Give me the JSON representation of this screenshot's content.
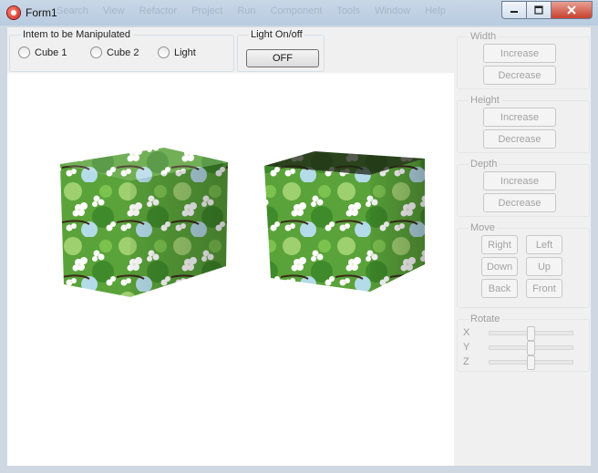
{
  "window": {
    "title": "Form1"
  },
  "manip_group": {
    "label": "Intem to be Manipulated",
    "options": [
      "Cube 1",
      "Cube 2",
      "Light"
    ]
  },
  "light_group": {
    "label": "Light On/off",
    "button": "OFF"
  },
  "width_group": {
    "label": "Width",
    "increase": "Increase",
    "decrease": "Decrease"
  },
  "height_group": {
    "label": "Height",
    "increase": "Increase",
    "decrease": "Decrease"
  },
  "depth_group": {
    "label": "Depth",
    "increase": "Increase",
    "decrease": "Decrease"
  },
  "move_group": {
    "label": "Move",
    "right": "Right",
    "left": "Left",
    "down": "Down",
    "up": "Up",
    "back": "Back",
    "front": "Front"
  },
  "rotate_group": {
    "label": "Rotate",
    "axes": [
      "X",
      "Y",
      "Z"
    ],
    "values": [
      0.5,
      0.5,
      0.5
    ]
  },
  "icons": {
    "app": "app-icon",
    "minimize": "minimize-icon",
    "maximize": "maximize-icon",
    "close": "close-icon"
  }
}
